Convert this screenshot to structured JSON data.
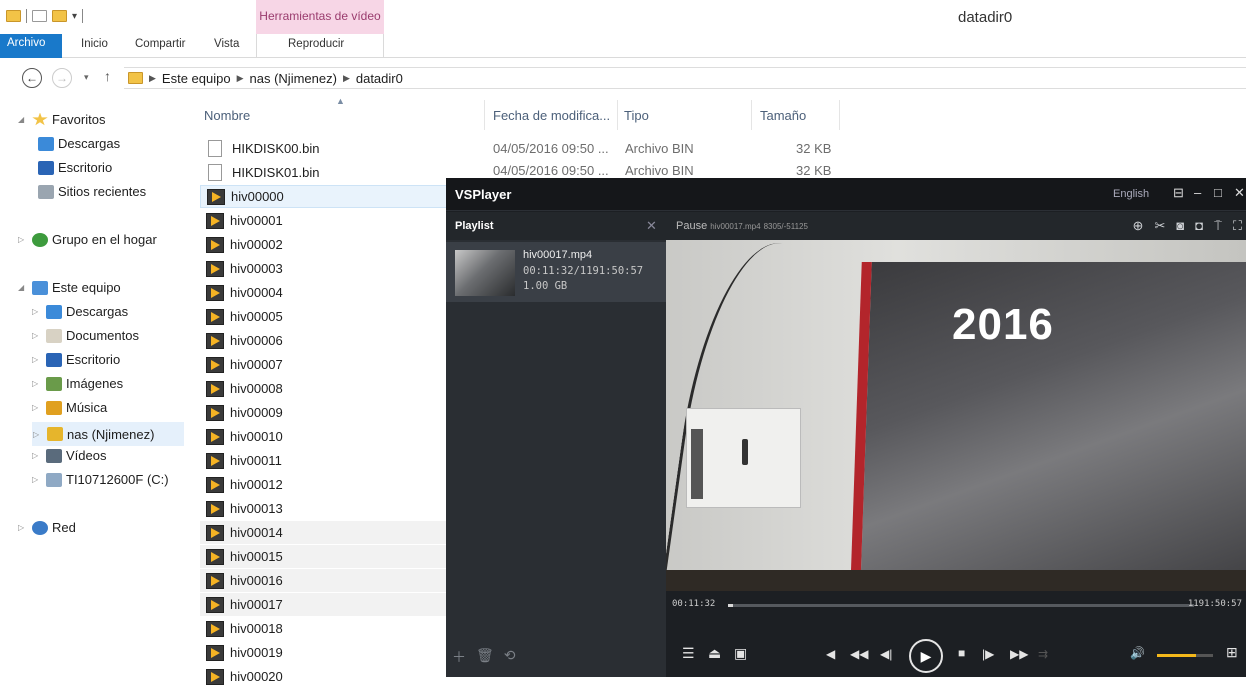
{
  "window": {
    "title": "datadir0",
    "context_tab": "Herramientas de vídeo"
  },
  "ribbon": {
    "tabs": [
      "Archivo",
      "Inicio",
      "Compartir",
      "Vista",
      "Reproducir"
    ]
  },
  "address": {
    "parts": [
      "Este equipo",
      "nas (Njimenez)",
      "datadir0"
    ]
  },
  "nav": {
    "favoritos": "Favoritos",
    "descargas": "Descargas",
    "escritorio": "Escritorio",
    "sitios": "Sitios recientes",
    "grupo": "Grupo en el hogar",
    "equipo": "Este equipo",
    "eq_descargas": "Descargas",
    "documentos": "Documentos",
    "eq_escritorio": "Escritorio",
    "imagenes": "Imágenes",
    "musica": "Música",
    "nas": "nas (Njimenez)",
    "videos": "Vídeos",
    "drive": "TI10712600F (C:)",
    "red": "Red"
  },
  "columns": {
    "name": "Nombre",
    "date": "Fecha de modifica...",
    "type": "Tipo",
    "size": "Tamaño"
  },
  "files": [
    {
      "name": "HIKDISK00.bin",
      "date": "04/05/2016 09:50 ...",
      "type": "Archivo BIN",
      "size": "32 KB"
    },
    {
      "name": "HIKDISK01.bin",
      "date": "04/05/2016 09:50 ...",
      "type": "Archivo BIN",
      "size": "32 KB"
    },
    {
      "name": "hiv00000"
    },
    {
      "name": "hiv00001"
    },
    {
      "name": "hiv00002"
    },
    {
      "name": "hiv00003"
    },
    {
      "name": "hiv00004"
    },
    {
      "name": "hiv00005"
    },
    {
      "name": "hiv00006"
    },
    {
      "name": "hiv00007"
    },
    {
      "name": "hiv00008"
    },
    {
      "name": "hiv00009"
    },
    {
      "name": "hiv00010"
    },
    {
      "name": "hiv00011"
    },
    {
      "name": "hiv00012"
    },
    {
      "name": "hiv00013"
    },
    {
      "name": "hiv00014"
    },
    {
      "name": "hiv00015"
    },
    {
      "name": "hiv00016"
    },
    {
      "name": "hiv00017"
    },
    {
      "name": "hiv00018"
    },
    {
      "name": "hiv00019"
    },
    {
      "name": "hiv00020"
    }
  ],
  "player": {
    "title": "VSPlayer",
    "lang": "English",
    "playlist_title": "Playlist",
    "item": {
      "name": "hiv00017.mp4",
      "time": "00:11:32/1191:50:57",
      "size": "1.00 GB"
    },
    "status": "Pause",
    "status_file": "hiv00017.mp4",
    "status_frames": "8305/-51125",
    "current_time": "00:11:32",
    "total_time": "1191:50:57",
    "progress": 0.01,
    "volume": 0.7,
    "video_text": "2016"
  },
  "colors": {
    "accent": "#1979ca",
    "player_bg": "#1c1f23",
    "volume": "#f4b81b"
  }
}
